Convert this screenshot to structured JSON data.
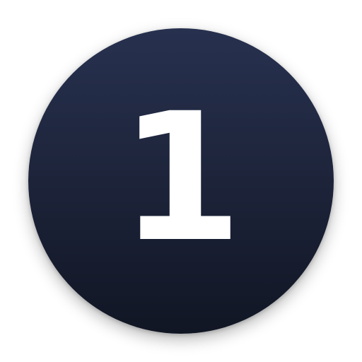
{
  "badge": {
    "number": "1",
    "background_top": "#27314f",
    "background_bottom": "#111624",
    "text_color": "#ffffff"
  }
}
